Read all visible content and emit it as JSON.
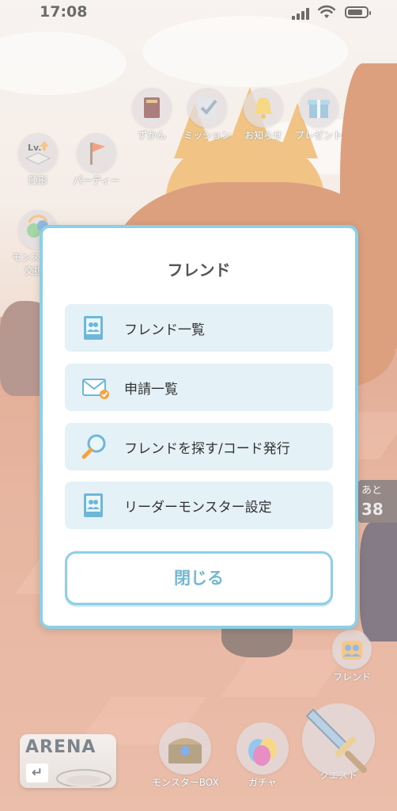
{
  "status_bar": {
    "time": "17:08"
  },
  "top_menu": [
    {
      "label": "ずかん",
      "icon": "book-icon"
    },
    {
      "label": "ミッション",
      "icon": "mission-check-icon"
    },
    {
      "label": "お知らせ",
      "icon": "bell-icon"
    },
    {
      "label": "プレゼント",
      "icon": "gift-icon"
    }
  ],
  "left_menu": [
    {
      "label": "陣形",
      "icon": "level-up-formation-icon",
      "badge": "Lv."
    },
    {
      "label": "パーティー",
      "icon": "flag-icon"
    },
    {
      "label": "モンス",
      "label2": "交換",
      "icon": "monster-exchange-icon"
    }
  ],
  "side_panel": {
    "text": "あと",
    "value": "38"
  },
  "dialog": {
    "title": "フレンド",
    "items": [
      {
        "label": "フレンド一覧",
        "icon": "friend-book-icon"
      },
      {
        "label": "申請一覧",
        "icon": "mail-check-icon"
      },
      {
        "label": "フレンドを探す/コード発行",
        "icon": "magnifier-icon"
      },
      {
        "label": "リーダーモンスター設定",
        "icon": "friend-book-icon"
      }
    ],
    "close_label": "閉じる"
  },
  "friend_button": {
    "label": "フレンド",
    "icon": "friends-icon"
  },
  "bottom_nav": {
    "arena": {
      "label": "ARENA",
      "arrow": "↵"
    },
    "box_label": "モンスターBOX",
    "gacha_label": "ガチャ",
    "quest_label": "クエスト"
  },
  "colors": {
    "dialog_border": "#8dcfe6",
    "item_bg": "#e4f1f7",
    "close_text": "#74b8d0"
  }
}
